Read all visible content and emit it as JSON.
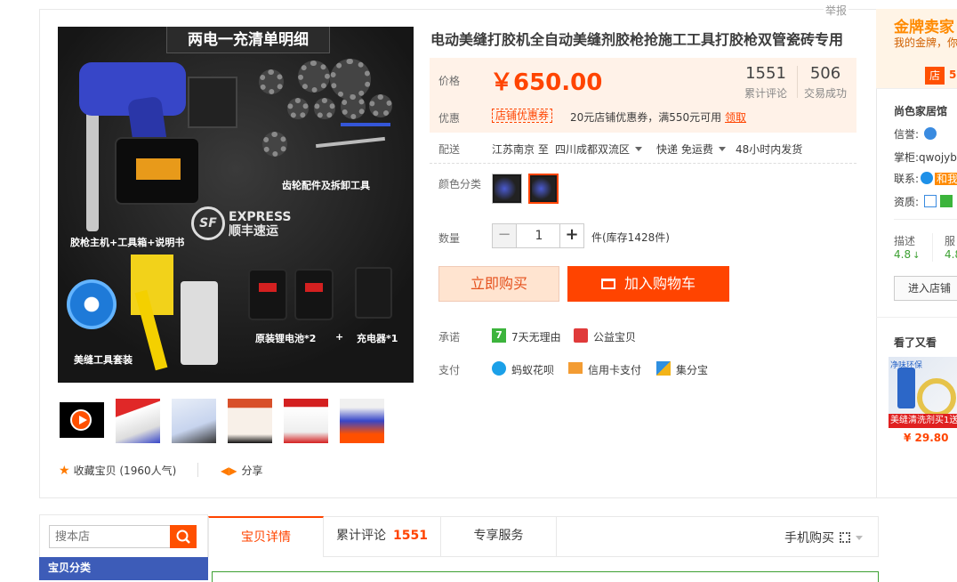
{
  "header": {
    "report_label": "举报"
  },
  "gallery": {
    "banner": "两电一充清单明细",
    "captions": {
      "gears": "齿轮配件及拆卸工具",
      "express_en": "EXPRESS",
      "express_cn": "顺丰速运",
      "sf_logo": "SF",
      "host": "胶枪主机+工具箱+说明书",
      "batteries": "原装锂电池*2",
      "plus": "+",
      "charger": "充电器*1",
      "kit": "美缝工具套装"
    },
    "thumbs": [
      "video",
      "thumb-1",
      "thumb-2",
      "thumb-3",
      "thumb-4",
      "thumb-5"
    ]
  },
  "actions": {
    "favorite": "收藏宝贝 (1960人气)",
    "share": "分享"
  },
  "product": {
    "title": "电动美缝打胶机全自动美缝剂胶枪抢施工工具打胶枪双管瓷砖专用",
    "price_label": "价格",
    "price": "￥650.00",
    "reviews_count": "1551",
    "reviews_label": "累计评论",
    "sales_count": "506",
    "sales_label": "交易成功",
    "promo_label": "优惠",
    "coupon_tag": "店铺优惠券",
    "coupon_text": "20元店铺优惠券，满550元可用",
    "coupon_claim": "领取",
    "delivery_label": "配送",
    "delivery_from": "江苏南京 至",
    "delivery_to": "四川成都双流区",
    "shipping": "快递 免运费",
    "dispatch": "48小时内发货",
    "color_label": "颜色分类",
    "qty_label": "数量",
    "qty_value": "1",
    "stock": "件(库存1428件)",
    "buy_now": "立即购买",
    "add_cart": "加入购物车",
    "promise_label": "承诺",
    "promise_1": "7天无理由",
    "promise_2": "公益宝贝",
    "pay_label": "支付",
    "pay_1": "蚂蚁花呗",
    "pay_2": "信用卡支付",
    "pay_3": "集分宝"
  },
  "shop": {
    "gold_title": "金牌卖家",
    "gold_sub": "我的金牌，你",
    "store_icon": "店",
    "store_num": "5",
    "name": "尚色家居馆",
    "credit_label": "信誉:",
    "owner_label": "掌柜:",
    "owner": "qwojyb",
    "contact_label": "联系:",
    "contact_text": "和我",
    "quals_label": "资质:",
    "rate_1_label": "描述",
    "rate_1": "4.8",
    "rate_2_label": "服",
    "rate_2": "4.8",
    "enter_store": "进入店铺",
    "see_also": "看了又看",
    "rec_brand": "净味环保",
    "rec_band": "美缝清洗剂买1送",
    "rec_price": "¥ 29.80"
  },
  "bottom": {
    "search_placeholder": "搜本店",
    "category_title": "宝贝分类",
    "tabs": [
      {
        "label": "宝贝详情"
      },
      {
        "label": "累计评论",
        "count": "1551"
      },
      {
        "label": "专享服务"
      }
    ],
    "mobile_buy": "手机购买"
  },
  "colors": {
    "accent": "#ff4400",
    "price_bg": "#fff2e8",
    "category_bar": "#3d5cb8"
  }
}
